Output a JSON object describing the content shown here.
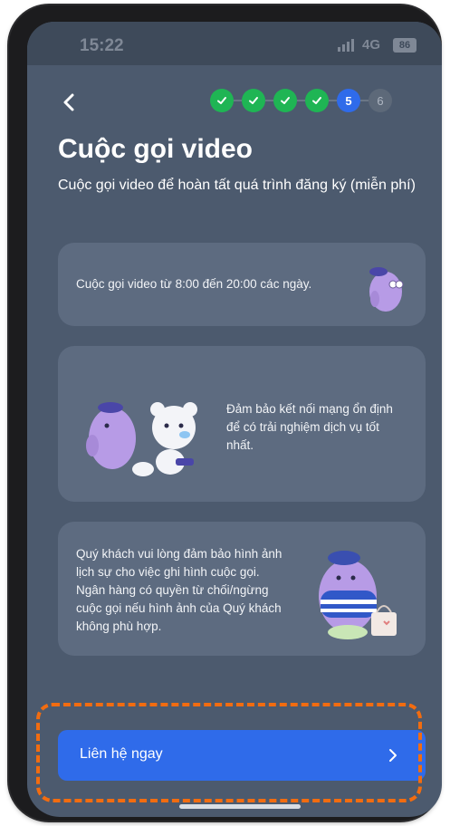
{
  "status_bar": {
    "time": "15:22",
    "network": "4G",
    "battery": "86"
  },
  "header": {
    "back_icon": "chevron-left-icon",
    "steps": [
      {
        "label": "",
        "state": "done"
      },
      {
        "label": "",
        "state": "done"
      },
      {
        "label": "",
        "state": "done"
      },
      {
        "label": "",
        "state": "done"
      },
      {
        "label": "5",
        "state": "active"
      },
      {
        "label": "6",
        "state": "todo"
      }
    ]
  },
  "page": {
    "title": "Cuộc gọi video",
    "subtitle": "Cuộc gọi video để hoàn tất quá trình đăng ký (miễn phí)"
  },
  "cards": [
    {
      "text": "Cuộc gọi video từ 8:00 đến 20:00 các ngày."
    },
    {
      "text": "Đảm bảo kết nối mạng ổn định để có trải nghiệm dịch vụ tốt nhất."
    },
    {
      "text": "Quý khách vui lòng đảm bảo hình ảnh lịch sự cho việc ghi hình cuộc gọi. Ngân hàng có quyền từ chối/ngừng cuộc gọi nếu hình ảnh của Quý khách không phù hợp."
    }
  ],
  "cta": {
    "label": "Liên hệ ngay",
    "icon": "chevron-right-icon"
  },
  "colors": {
    "background": "#4c5a6e",
    "card": "#5d6b80",
    "accent": "#2f6bea",
    "step_done": "#1fb554",
    "highlight": "#f26c10"
  }
}
